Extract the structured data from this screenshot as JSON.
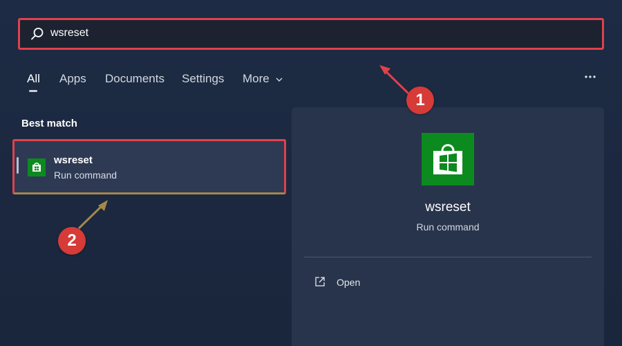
{
  "search": {
    "query": "wsreset"
  },
  "tabs": [
    {
      "label": "All",
      "active": true
    },
    {
      "label": "Apps"
    },
    {
      "label": "Documents"
    },
    {
      "label": "Settings"
    },
    {
      "label": "More"
    }
  ],
  "icons": {
    "search": "search-icon",
    "more_chevron": "chevron-down-icon",
    "options": "more-options-icon",
    "app": "microsoft-store-icon",
    "open": "open-external-icon"
  },
  "best_match": {
    "title": "Best match",
    "item": {
      "name": "wsreset",
      "type": "Run command"
    }
  },
  "preview": {
    "name": "wsreset",
    "type": "Run command",
    "actions": [
      {
        "label": "Open"
      }
    ]
  },
  "annotations": [
    {
      "label": "1"
    },
    {
      "label": "2"
    }
  ],
  "colors": {
    "highlight_border": "#e0414b",
    "annotation_badge": "#d63b37",
    "store_green": "#0c8a1f"
  }
}
